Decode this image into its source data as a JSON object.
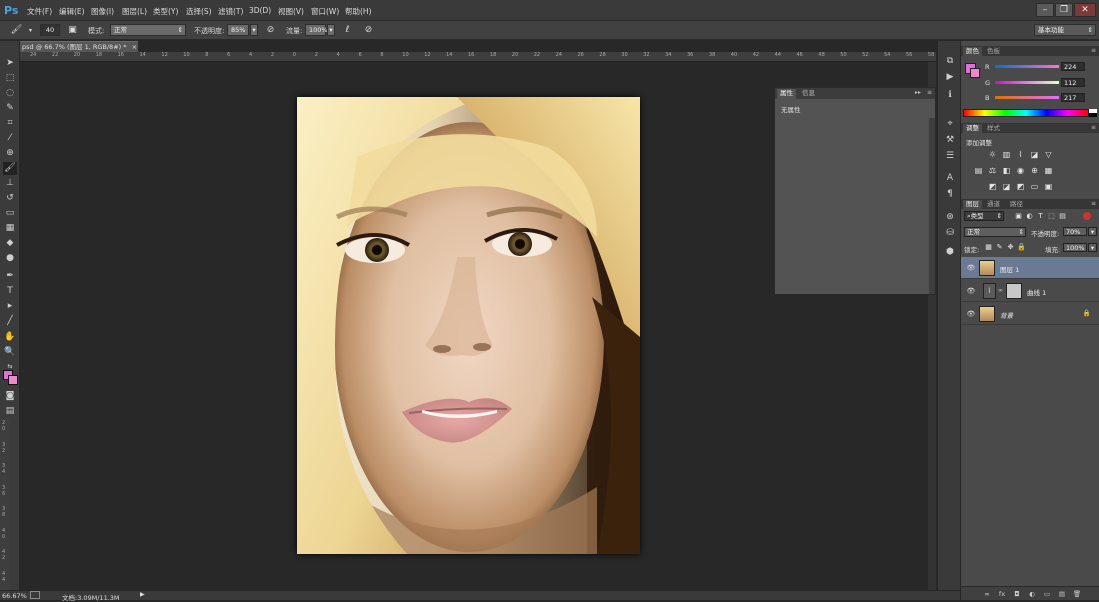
{
  "app": {
    "logo": "Ps"
  },
  "menu": [
    "文件(F)",
    "编辑(E)",
    "图像(I)",
    "图层(L)",
    "类型(Y)",
    "选择(S)",
    "滤镜(T)",
    "3D(D)",
    "视图(V)",
    "窗口(W)",
    "帮助(H)"
  ],
  "window_controls": {
    "minimize": "–",
    "restore": "❐",
    "close": "✕"
  },
  "options": {
    "brush_size": "40",
    "mode_label": "模式:",
    "mode_value": "正常",
    "opacity_label": "不透明度:",
    "opacity_value": "85%",
    "flow_label": "流量:",
    "flow_value": "100%",
    "workspace": "基本功能"
  },
  "document": {
    "tab_title": "psd @ 66.7% (图层 1, RGB/8#) *",
    "tab_close": "×"
  },
  "ruler": {
    "h_ticks": [
      "24",
      "22",
      "20",
      "18",
      "16",
      "14",
      "12",
      "10",
      "8",
      "6",
      "4",
      "2",
      "0",
      "2",
      "4",
      "6",
      "8",
      "10",
      "12",
      "14",
      "16",
      "18",
      "20",
      "22",
      "24",
      "26",
      "28",
      "30",
      "32",
      "34",
      "36",
      "38",
      "40",
      "42",
      "44",
      "46",
      "48",
      "50",
      "52",
      "54",
      "56",
      "58"
    ],
    "v_ticks": [
      "2 0",
      "3 2",
      "3 4",
      "3 6",
      "3 8",
      "4 0",
      "4 2",
      "4 4"
    ]
  },
  "status": {
    "zoom": "66.67%",
    "doc_info": "文档:3.09M/11.3M"
  },
  "properties_panel": {
    "tabs": [
      "属性",
      "信息"
    ],
    "content": "无属性"
  },
  "color_panel": {
    "tabs": [
      "颜色",
      "色板"
    ],
    "channels": [
      {
        "label": "R",
        "value": "224"
      },
      {
        "label": "G",
        "value": "112"
      },
      {
        "label": "B",
        "value": "217"
      }
    ],
    "foreground": "#e070d9",
    "background": "#ee88cc"
  },
  "adjust_panel": {
    "tabs": [
      "调整",
      "样式"
    ],
    "title": "添加调整"
  },
  "layers_panel": {
    "tabs": [
      "图层",
      "通道",
      "路径"
    ],
    "filter": "类型",
    "blend_mode": "正常",
    "opacity_label": "不透明度:",
    "opacity_value": "70%",
    "lock_label": "锁定:",
    "fill_label": "填充:",
    "fill_value": "100%",
    "layers": [
      {
        "name": "图层 1",
        "selected": true
      },
      {
        "name": "曲线 1",
        "selected": false
      },
      {
        "name": "背景",
        "selected": false
      }
    ],
    "footer": [
      "∞",
      "fx",
      "◘",
      "◐",
      "▭",
      "▤",
      "🗑"
    ]
  }
}
